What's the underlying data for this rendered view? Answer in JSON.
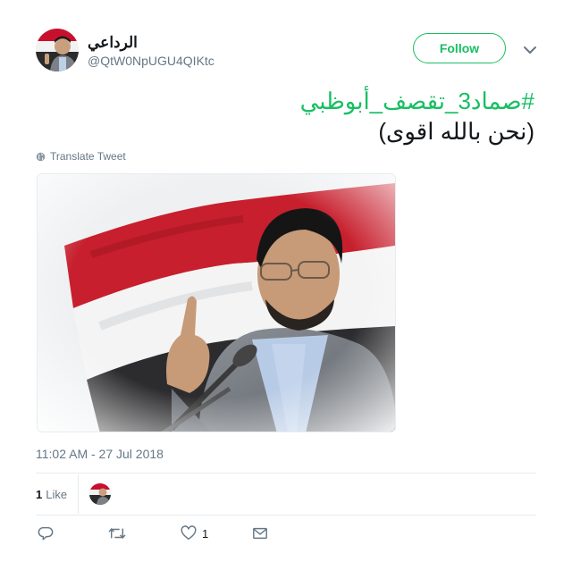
{
  "user": {
    "display_name": "الرداعي",
    "handle": "@QtW0NpUGU4QIKtc",
    "avatar_icon": "profile-photo-avatar"
  },
  "header": {
    "follow_label": "Follow",
    "menu_icon": "chevron-down-icon"
  },
  "tweet": {
    "hashtag": "#صماد3_تقصف_أبوظبي",
    "text": "(نحن بالله اقوى)",
    "translate_label": "Translate Tweet",
    "timestamp": "11:02 AM - 27 Jul 2018"
  },
  "stats": {
    "likes_count": "1",
    "likes_label": "Like"
  },
  "actions": {
    "reply_icon": "reply-icon",
    "retweet_icon": "retweet-icon",
    "like_icon": "heart-icon",
    "like_count": "1",
    "dm_icon": "envelope-icon"
  },
  "colors": {
    "accent": "#17bf63",
    "muted": "#657786",
    "divider": "#e6ecf0"
  }
}
